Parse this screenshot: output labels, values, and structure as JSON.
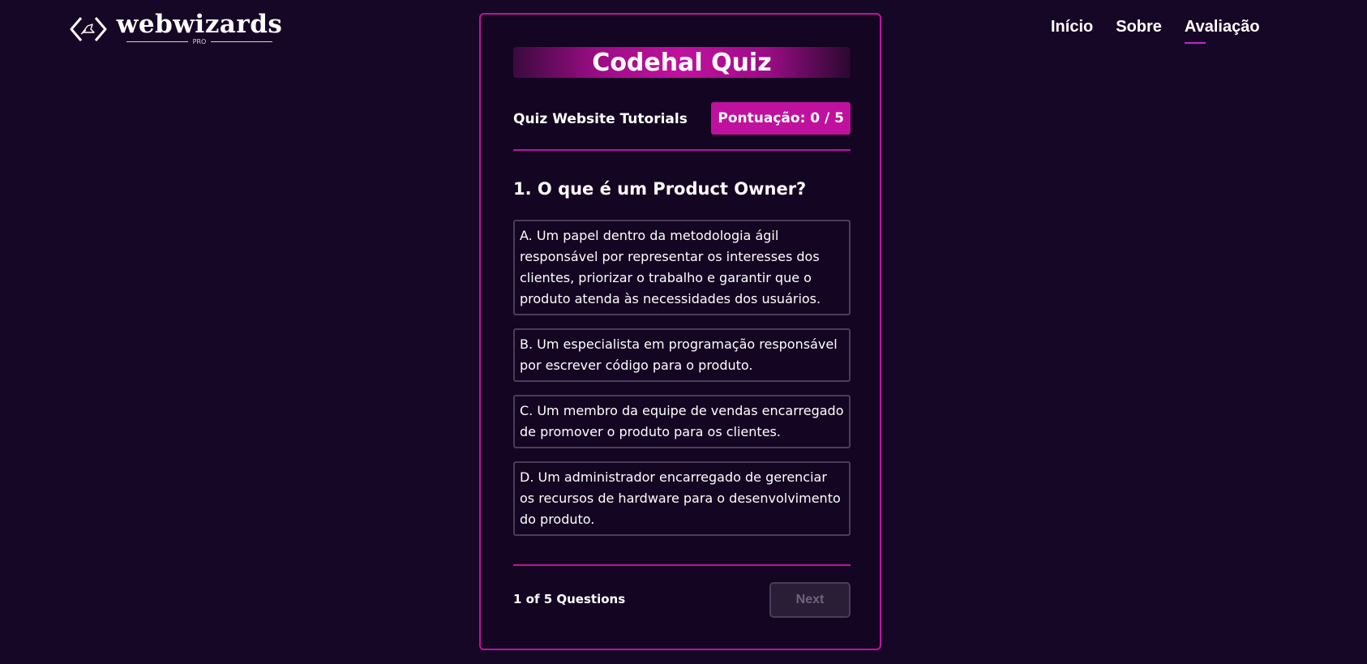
{
  "header": {
    "logo": {
      "name": "webwizards",
      "sub": "PRO"
    },
    "nav": [
      {
        "label": "Início",
        "active": false
      },
      {
        "label": "Sobre",
        "active": false
      },
      {
        "label": "Avaliação",
        "active": true
      }
    ]
  },
  "quiz": {
    "title": "Codehal Quiz",
    "subtitle": "Quiz Website Tutorials",
    "score": "Pontuação: 0 / 5",
    "question": "1. O que é um Product Owner?",
    "options": [
      "A. Um papel dentro da metodologia ágil responsável por representar os interesses dos clientes, priorizar o trabalho e garantir que o produto atenda às necessidades dos usuários.",
      "B. Um especialista em programação responsável por escrever código para o produto.",
      "C. Um membro da equipe de vendas encarregado de promover o produto para os clientes.",
      "D. Um administrador encarregado de gerenciar os recursos de hardware para o desenvolvimento do produto."
    ],
    "counter": "1 of 5 Questions",
    "next_label": "Next"
  },
  "colors": {
    "background": "#170726",
    "accent": "#c0119e",
    "option_border": "#4a3d59",
    "button_disabled_text": "#6f6380"
  },
  "icons": {
    "logo": "code-brackets-wizard-icon"
  }
}
